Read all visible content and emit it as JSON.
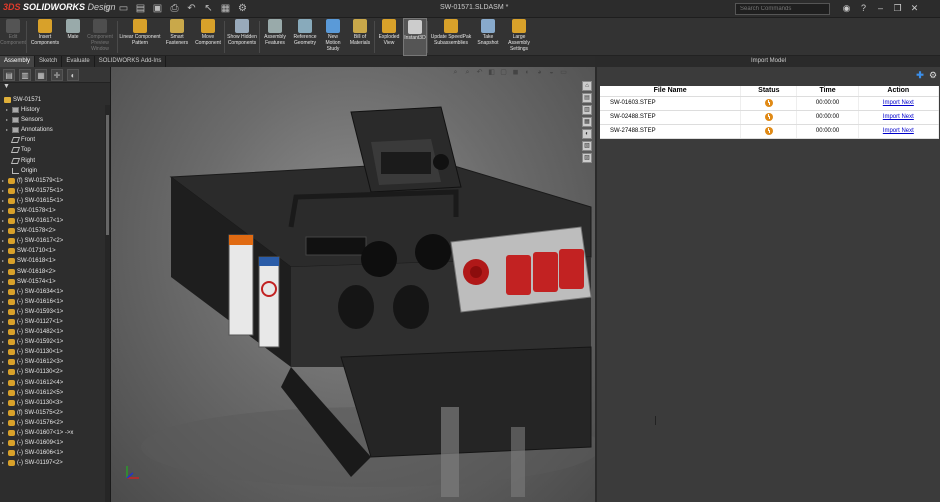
{
  "app": {
    "logo_ds": "3DS",
    "logo_name": "SOLIDWORKS",
    "logo_suffix": "Design",
    "document_title": "SW-01571.SLDASM *"
  },
  "search": {
    "placeholder": "Search Commands"
  },
  "ribbon": [
    {
      "label": "Edit Component",
      "enabled": false,
      "icon": "edit-component-icon"
    },
    {
      "label": "Insert Components",
      "enabled": true,
      "icon": "insert-components-icon"
    },
    {
      "label": "Mate",
      "enabled": true,
      "icon": "mate-icon"
    },
    {
      "label": "Component Preview Window",
      "enabled": false,
      "icon": "preview-window-icon"
    },
    {
      "label": "Linear Component Pattern",
      "enabled": true,
      "icon": "linear-pattern-icon"
    },
    {
      "label": "Smart Fasteners",
      "enabled": true,
      "icon": "smart-fasteners-icon"
    },
    {
      "label": "Move Component",
      "enabled": true,
      "icon": "move-component-icon"
    },
    {
      "label": "Show Hidden Components",
      "enabled": true,
      "icon": "show-hidden-icon"
    },
    {
      "label": "Assembly Features",
      "enabled": true,
      "icon": "assembly-features-icon"
    },
    {
      "label": "Reference Geometry",
      "enabled": true,
      "icon": "reference-geometry-icon"
    },
    {
      "label": "New Motion Study",
      "enabled": true,
      "icon": "motion-study-icon"
    },
    {
      "label": "Bill of Materials",
      "enabled": true,
      "icon": "bom-icon"
    },
    {
      "label": "Exploded View",
      "enabled": true,
      "icon": "exploded-view-icon"
    },
    {
      "label": "Instant3D",
      "enabled": true,
      "icon": "instant3d-icon",
      "active": true
    },
    {
      "label": "Update SpeedPak Subassemblies",
      "enabled": true,
      "icon": "speedpak-icon"
    },
    {
      "label": "Take Snapshot",
      "enabled": true,
      "icon": "snapshot-icon"
    },
    {
      "label": "Large Assembly Settings",
      "enabled": true,
      "icon": "large-assembly-icon"
    }
  ],
  "tabs": [
    "Assembly",
    "Sketch",
    "Evaluate",
    "SOLIDWORKS Add-Ins"
  ],
  "tree": {
    "root": "SW-01571",
    "items": [
      {
        "label": "History",
        "icon": "folder"
      },
      {
        "label": "Sensors",
        "icon": "folder"
      },
      {
        "label": "Annotations",
        "icon": "folder"
      },
      {
        "label": "Front",
        "icon": "plane"
      },
      {
        "label": "Top",
        "icon": "plane"
      },
      {
        "label": "Right",
        "icon": "plane"
      },
      {
        "label": "Origin",
        "icon": "origin"
      },
      {
        "label": "(f) SW-01579<1>",
        "icon": "part"
      },
      {
        "label": "(-) SW-01575<1>",
        "icon": "part"
      },
      {
        "label": "(-) SW-01615<1>",
        "icon": "part"
      },
      {
        "label": "SW-01578<1>",
        "icon": "part"
      },
      {
        "label": "(-) SW-01617<1>",
        "icon": "part"
      },
      {
        "label": "SW-01578<2>",
        "icon": "part"
      },
      {
        "label": "(-) SW-01617<2>",
        "icon": "part"
      },
      {
        "label": "SW-01710<1>",
        "icon": "part"
      },
      {
        "label": "SW-01618<1>",
        "icon": "part"
      },
      {
        "label": "SW-01618<2>",
        "icon": "part"
      },
      {
        "label": "SW-01574<1>",
        "icon": "part"
      },
      {
        "label": "(-) SW-01634<1>",
        "icon": "part"
      },
      {
        "label": "(-) SW-01616<1>",
        "icon": "part"
      },
      {
        "label": "(-) SW-01593<1>",
        "icon": "part"
      },
      {
        "label": "(-) SW-01127<1>",
        "icon": "part"
      },
      {
        "label": "(-) SW-01482<1>",
        "icon": "part"
      },
      {
        "label": "(-) SW-01592<1>",
        "icon": "part"
      },
      {
        "label": "(-) SW-01130<1>",
        "icon": "part"
      },
      {
        "label": "(-) SW-01612<3>",
        "icon": "part"
      },
      {
        "label": "(-) SW-01130<2>",
        "icon": "part"
      },
      {
        "label": "(-) SW-01612<4>",
        "icon": "part"
      },
      {
        "label": "(-) SW-01612<5>",
        "icon": "part"
      },
      {
        "label": "(-) SW-01130<3>",
        "icon": "part"
      },
      {
        "label": "(f) SW-01575<2>",
        "icon": "part"
      },
      {
        "label": "(-) SW-01576<2>",
        "icon": "part"
      },
      {
        "label": "(-) SW-01607<1> ->x",
        "icon": "part"
      },
      {
        "label": "(-) SW-01609<1>",
        "icon": "part"
      },
      {
        "label": "(-) SW-01606<1>",
        "icon": "part"
      },
      {
        "label": "(-) SW-01197<2>",
        "icon": "part"
      }
    ]
  },
  "import_panel": {
    "title": "Import Model",
    "columns": [
      "File Name",
      "Status",
      "Time",
      "Action"
    ],
    "rows": [
      {
        "file": "SW-01603.STEP",
        "time": "00:00:00",
        "action": "Import Next"
      },
      {
        "file": "SW-02488.STEP",
        "time": "00:00:00",
        "action": "Import Next"
      },
      {
        "file": "SW-27488.STEP",
        "time": "00:00:00",
        "action": "Import Next"
      }
    ]
  },
  "colors": {
    "accent": "#3b8ee8",
    "status_pending": "#e08a16",
    "link": "#0000cc"
  }
}
